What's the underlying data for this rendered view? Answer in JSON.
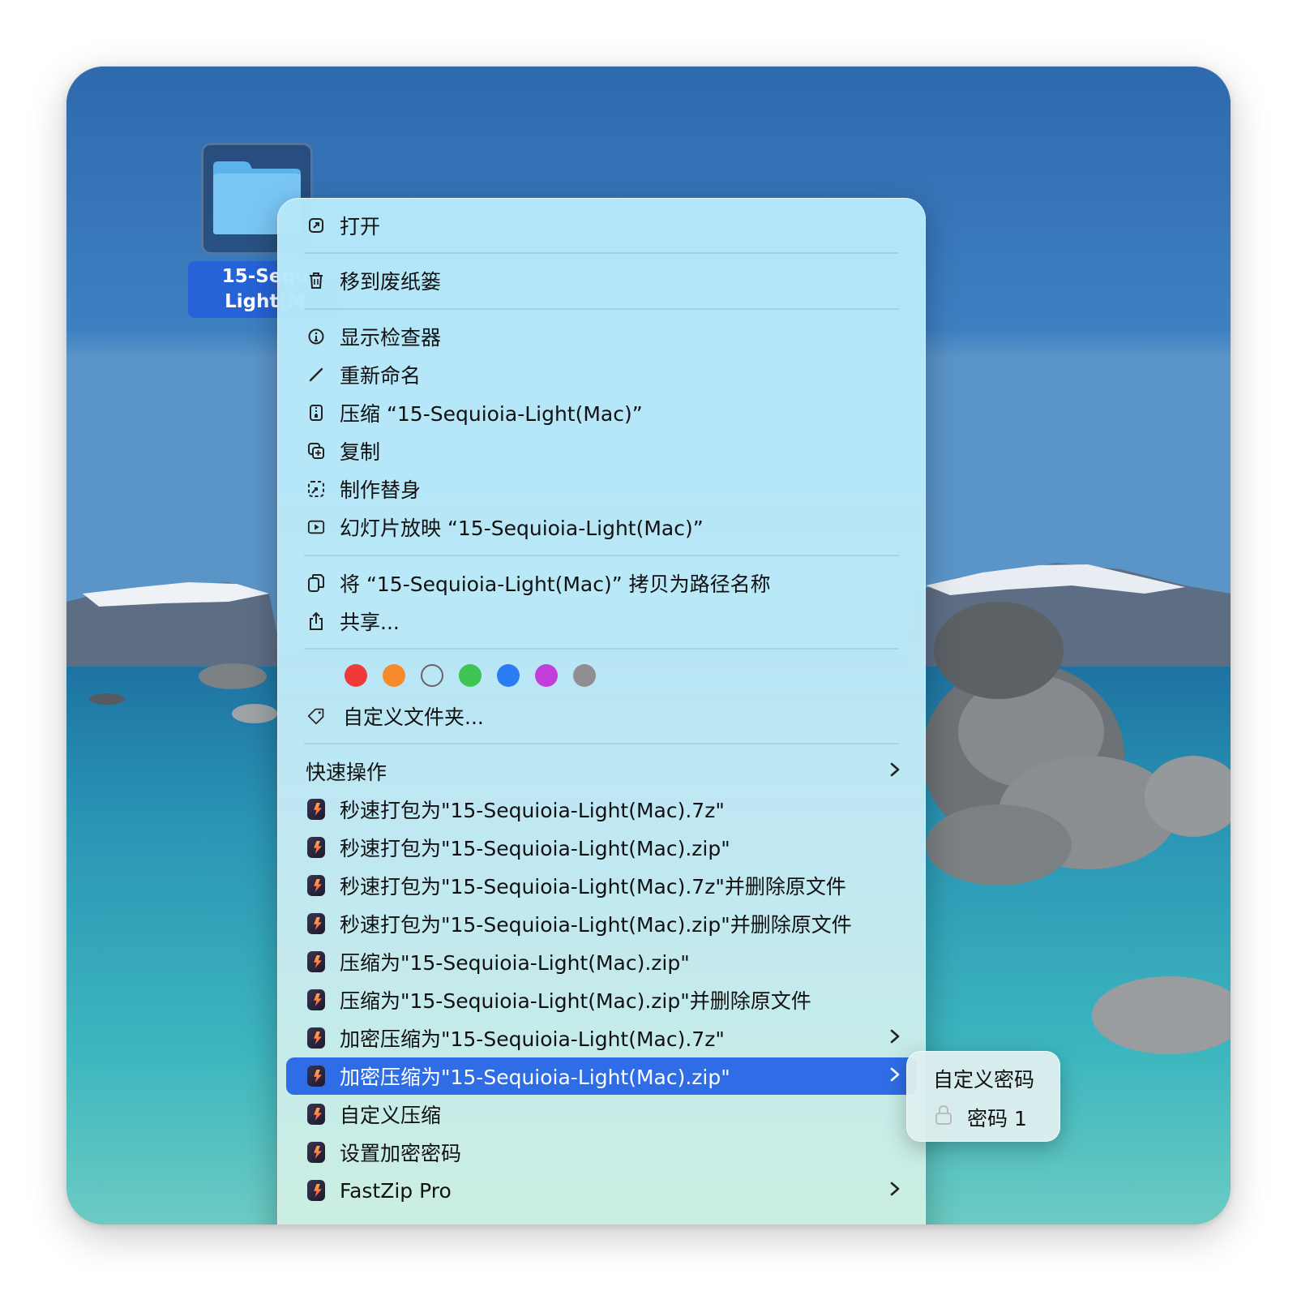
{
  "desktop": {
    "folder_label_line1": "15-Sequ",
    "folder_label_line2": "Light(M"
  },
  "menu": {
    "open": "打开",
    "trash": "移到废纸篓",
    "inspector": "显示检查器",
    "rename": "重新命名",
    "compress": "压缩 “15-Sequioia-Light(Mac)”",
    "duplicate": "复制",
    "alias": "制作替身",
    "slideshow": "幻灯片放映 “15-Sequioia-Light(Mac)”",
    "copy_path": "将 “15-Sequioia-Light(Mac)” 拷贝为路径名称",
    "share": "共享...",
    "tag_colors": [
      "#f0393a",
      "#f78b2c",
      "transparent",
      "#3fc454",
      "#2b7cf2",
      "#c23edb",
      "#8e8e93"
    ],
    "customize_folder": "自定义文件夹...",
    "quick_actions": "快速操作",
    "fastzip_items": [
      "秒速打包为\"15-Sequioia-Light(Mac).7z\"",
      "秒速打包为\"15-Sequioia-Light(Mac).zip\"",
      "秒速打包为\"15-Sequioia-Light(Mac).7z\"并删除原文件",
      "秒速打包为\"15-Sequioia-Light(Mac).zip\"并删除原文件",
      "压缩为\"15-Sequioia-Light(Mac).zip\"",
      "压缩为\"15-Sequioia-Light(Mac).zip\"并删除原文件",
      "加密压缩为\"15-Sequioia-Light(Mac).7z\"",
      "加密压缩为\"15-Sequioia-Light(Mac).zip\"",
      "自定义压缩",
      "设置加密密码",
      "FastZip Pro"
    ],
    "highlight_color": "#2e6de6"
  },
  "submenu": {
    "custom_password": "自定义密码",
    "password1": "密码 1"
  }
}
